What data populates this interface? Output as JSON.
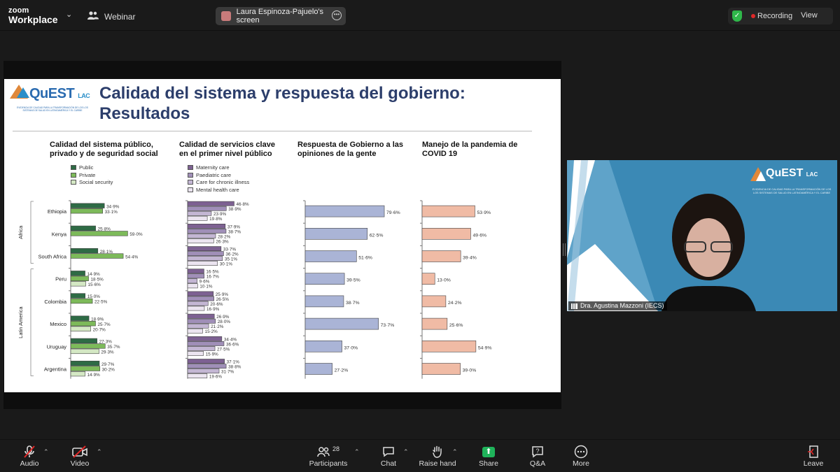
{
  "app": {
    "brand_line1": "zoom",
    "brand_line2": "Workplace",
    "webinar_label": "Webinar"
  },
  "share_indicator": {
    "label": "Laura Espinoza-Pajuelo's screen"
  },
  "recording": {
    "label": "Recording"
  },
  "view_button": {
    "label": "View"
  },
  "slide": {
    "logo_name": "QuEST",
    "logo_suffix": "LAC",
    "logo_subtitle": "EVIDENCIA DE CALIDAD PARA LA TRANSFORMACIÓN DE LOS LOS SISTEMAS DE SALUD EN LATINOAMÉRICA Y EL CARIBE",
    "title_line1": "Calidad del sistema y respuesta del gobierno:",
    "title_line2": "Resultados",
    "col1_head_line1": "Calidad del sistema público,",
    "col1_head_line2": "privado y de seguridad social",
    "col2_head_line1": "Calidad de servicios clave",
    "col2_head_line2": "en el primer nivel público",
    "col3_head_line1": "Respuesta de Gobierno a las",
    "col3_head_line2": "opiniones de la gente",
    "col4_head_line1": "Manejo de la pandemia de",
    "col4_head_line2": "COVID 19",
    "legend1": [
      "Public",
      "Private",
      "Social security"
    ],
    "legend2": [
      "Maternity care",
      "Paediatric care",
      "Care for chronic illness",
      "Mental health care"
    ]
  },
  "chart_data": [
    {
      "type": "bar",
      "title": "Calidad del sistema público, privado y de seguridad social",
      "groups": [
        {
          "name": "Africa",
          "countries": [
            "Ethiopia",
            "Kenya",
            "South Africa"
          ]
        },
        {
          "name": "Latin America",
          "countries": [
            "Peru",
            "Colombia",
            "Mexico",
            "Uruguay",
            "Argentina"
          ]
        }
      ],
      "categories": [
        "Ethiopia",
        "Kenya",
        "South Africa",
        "Peru",
        "Colombia",
        "Mexico",
        "Uruguay",
        "Argentina"
      ],
      "series": [
        {
          "name": "Public",
          "color": "#2e6b45",
          "values": [
            34.9,
            25.8,
            28.1,
            14.9,
            15.0,
            18.9,
            27.3,
            29.7
          ],
          "labels": [
            "34·9%",
            "25·8%",
            "28·1%",
            "14·9%",
            "15·0%",
            "18·9%",
            "27·3%",
            "29·7%"
          ]
        },
        {
          "name": "Private",
          "color": "#7dba5a",
          "values": [
            33.1,
            59.0,
            54.4,
            18.5,
            22.5,
            25.7,
            35.7,
            30.2
          ],
          "labels": [
            "33·1%",
            "59·0%",
            "54·4%",
            "18·5%",
            "22·5%",
            "25·7%",
            "35·7%",
            "30·2%"
          ]
        },
        {
          "name": "Social security",
          "color": "#d4e8c4",
          "values": [
            null,
            null,
            null,
            15.6,
            null,
            20.7,
            29.3,
            14.9
          ],
          "labels": [
            "",
            "",
            "",
            "15·6%",
            "",
            "20·7%",
            "29·3%",
            "14·9%"
          ]
        }
      ]
    },
    {
      "type": "bar",
      "title": "Calidad de servicios clave en el primer nivel público",
      "categories": [
        "Ethiopia",
        "Kenya",
        "South Africa",
        "Peru",
        "Colombia",
        "Mexico",
        "Uruguay",
        "Argentina"
      ],
      "series": [
        {
          "name": "Maternity care",
          "color": "#7d6192",
          "values": [
            46.8,
            37.9,
            33.7,
            16.5,
            25.9,
            26.9,
            34.4,
            37.1
          ],
          "labels": [
            "46·8%",
            "37·9%",
            "33·7%",
            "16·5%",
            "25·9%",
            "26·9%",
            "34·4%",
            "37·1%"
          ]
        },
        {
          "name": "Paediatric care",
          "color": "#a08fb8",
          "values": [
            38.9,
            38.7,
            36.2,
            16.7,
            26.5,
            28.0,
            36.6,
            38.8
          ],
          "labels": [
            "38·9%",
            "38·7%",
            "36·2%",
            "16·7%",
            "26·5%",
            "28·0%",
            "36·6%",
            "38·8%"
          ]
        },
        {
          "name": "Care for chronic illness",
          "color": "#c3b6d3",
          "values": [
            23.9,
            28.2,
            35.1,
            9.6,
            20.6,
            21.2,
            27.5,
            31.7
          ],
          "labels": [
            "23·9%",
            "28·2%",
            "35·1%",
            "9·6%",
            "20·6%",
            "21·2%",
            "27·5%",
            "31·7%"
          ]
        },
        {
          "name": "Mental health care",
          "color": "#ebe4f0",
          "values": [
            19.8,
            26.3,
            30.1,
            10.1,
            16.9,
            15.2,
            15.9,
            19.6
          ],
          "labels": [
            "19·8%",
            "26·3%",
            "30·1%",
            "10·1%",
            "16·9%",
            "15·2%",
            "15·9%",
            "19·6%"
          ]
        }
      ]
    },
    {
      "type": "bar",
      "title": "Respuesta de Gobierno a las opiniones de la gente",
      "categories": [
        "Ethiopia",
        "Kenya",
        "South Africa",
        "Peru",
        "Colombia",
        "Mexico",
        "Uruguay",
        "Argentina"
      ],
      "series": [
        {
          "color": "#aab4d6",
          "values": [
            79.6,
            62.5,
            51.6,
            39.5,
            38.7,
            73.7,
            37.0,
            27.2
          ],
          "labels": [
            "79·6%",
            "62·5%",
            "51·6%",
            "39·5%",
            "38·7%",
            "73·7%",
            "37·0%",
            "27·2%"
          ]
        }
      ]
    },
    {
      "type": "bar",
      "title": "Manejo de la pandemia de COVID 19",
      "categories": [
        "Ethiopia",
        "Kenya",
        "South Africa",
        "Peru",
        "Colombia",
        "Mexico",
        "Uruguay",
        "Argentina"
      ],
      "series": [
        {
          "color": "#f0bba5",
          "values": [
            53.9,
            49.6,
            39.4,
            13.0,
            24.2,
            25.6,
            54.9,
            39.0
          ],
          "labels": [
            "53·9%",
            "49·6%",
            "39·4%",
            "13·0%",
            "24·2%",
            "25·6%",
            "54·9%",
            "39·0%"
          ]
        }
      ]
    }
  ],
  "side_panel": {
    "logo_name": "QuEST",
    "logo_suffix": "LAC",
    "logo_subtitle": "EVIDENCIA DE CALIDAD PARA LA TRANSFORMACIÓN DE LOS LOS SISTEMAS DE SALUD EN LATINOAMÉRICA Y EL CARIBE",
    "participant_name": "Dra. Agustina Mazzoni (IECS)"
  },
  "toolbar": {
    "audio": "Audio",
    "video": "Video",
    "participants": "Participants",
    "participants_count": "28",
    "chat": "Chat",
    "raise_hand": "Raise hand",
    "share": "Share",
    "qa": "Q&A",
    "more": "More",
    "leave": "Leave"
  },
  "colors": {
    "zoom_bg": "#1a1a1a",
    "slide_title": "#2c3e6b",
    "side_panel": "#3b89b5",
    "share_green": "#1fb35a",
    "muted_red": "#e02828"
  }
}
